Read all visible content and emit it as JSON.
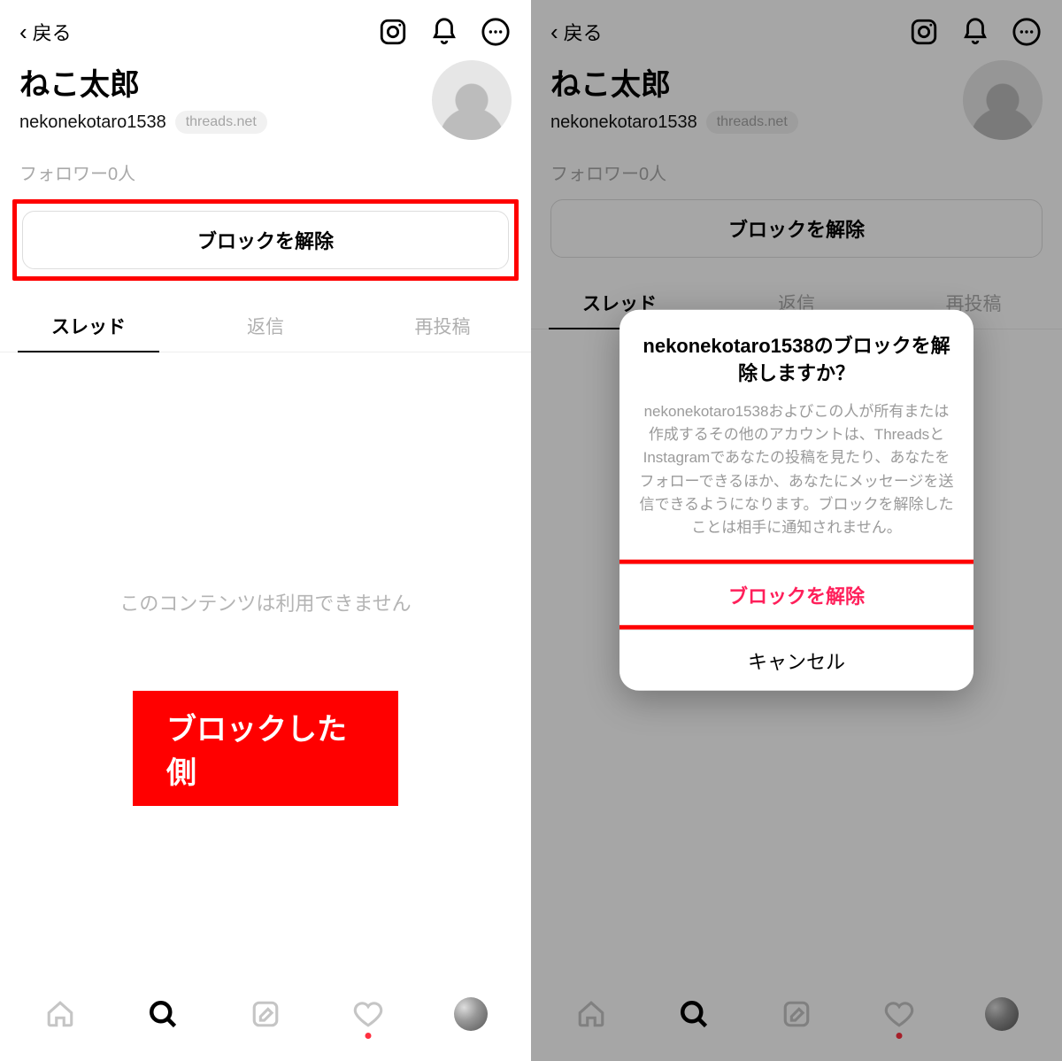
{
  "header": {
    "back_label": "戻る"
  },
  "profile": {
    "display_name": "ねこ太郎",
    "username": "nekonekotaro1538",
    "domain_pill": "threads.net",
    "followers_text": "フォロワー0人"
  },
  "actions": {
    "unblock_label": "ブロックを解除"
  },
  "tabs": {
    "threads": "スレッド",
    "replies": "返信",
    "reposts": "再投稿"
  },
  "content": {
    "empty_message": "このコンテンツは利用できません"
  },
  "caption": {
    "blocker_side": "ブロックした側"
  },
  "modal": {
    "title": "nekonekotaro1538のブロックを解除しますか？",
    "body": "nekonekotaro1538およびこの人が所有または作成するその他のアカウントは、ThreadsとInstagramであなたの投稿を見たり、あなたをフォローできるほか、あなたにメッセージを送信できるようになります。ブロックを解除したことは相手に通知されません。",
    "confirm": "ブロックを解除",
    "cancel": "キャンセル"
  }
}
